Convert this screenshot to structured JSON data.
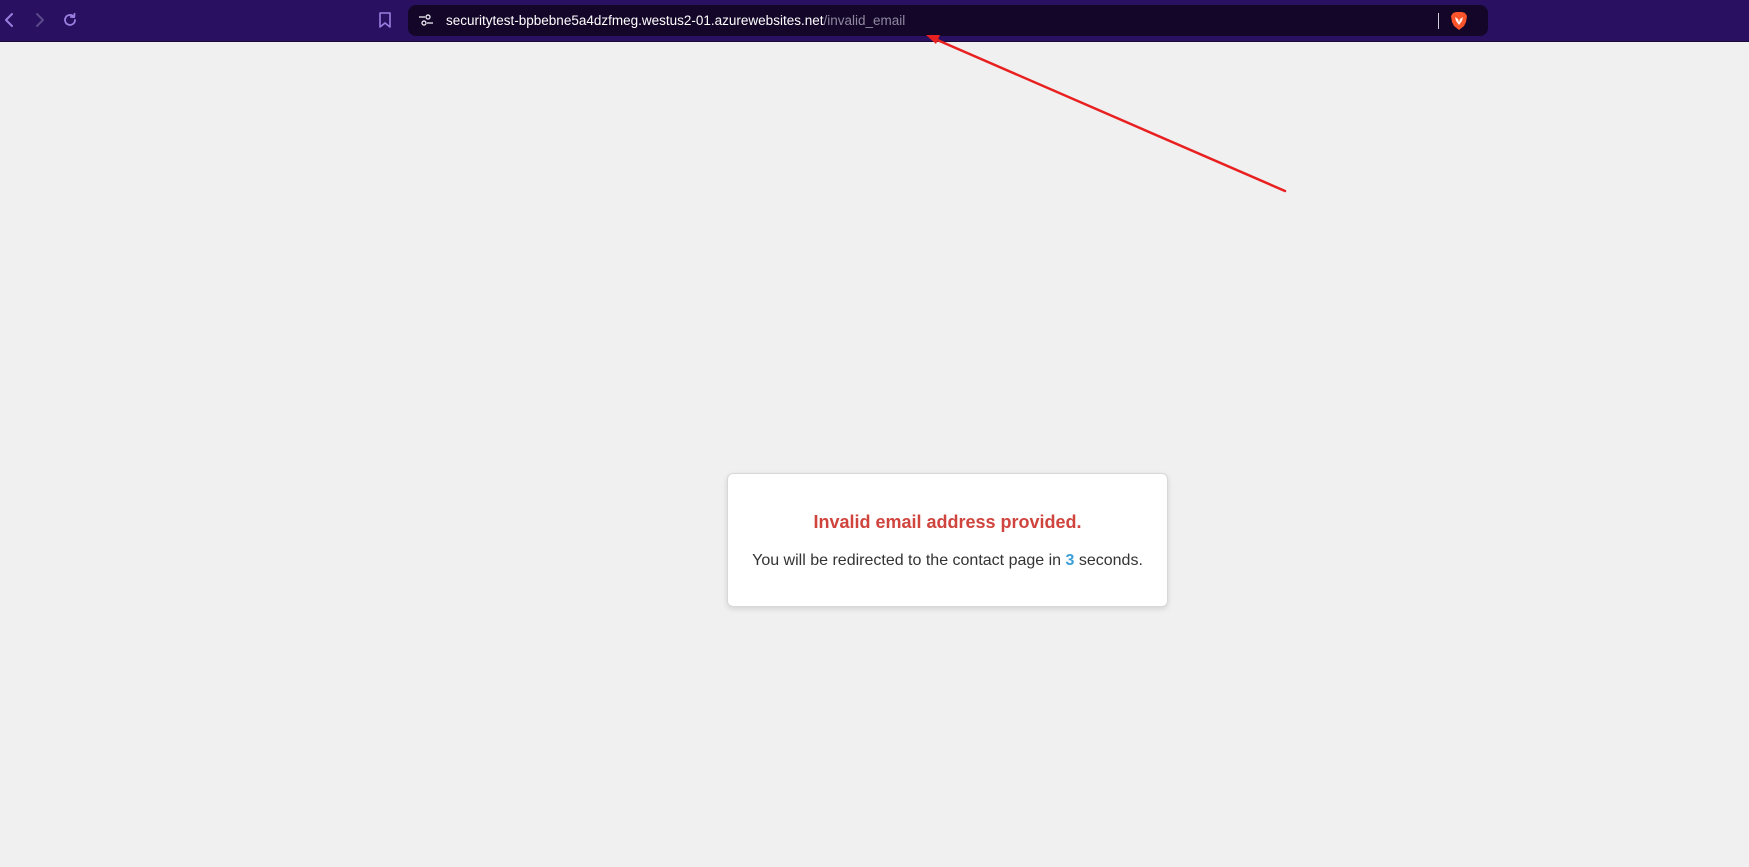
{
  "browser": {
    "url_host": "securitytest-bpbebne5a4dzfmeg.westus2-01.azurewebsites.net",
    "url_path": "/invalid_email",
    "colors": {
      "toolbar": "#2a1060",
      "urlbar": "#140628"
    },
    "icons": {
      "back": "chevron-left-icon",
      "forward": "chevron-right-icon",
      "reload": "reload-icon",
      "bookmark": "bookmark-icon",
      "site_info": "tune-icon",
      "shields": "brave-lion-icon"
    }
  },
  "page": {
    "background": "#f0f0f0",
    "message": {
      "title": "Invalid email address provided.",
      "text_before": "You will be redirected to the contact page in ",
      "countdown": "3",
      "text_after": " seconds.",
      "colors": {
        "title": "#d0443e",
        "countdown": "#3a9fd6"
      }
    }
  },
  "annotation": {
    "type": "arrow",
    "color": "#e82020",
    "points_to": "address-bar"
  }
}
